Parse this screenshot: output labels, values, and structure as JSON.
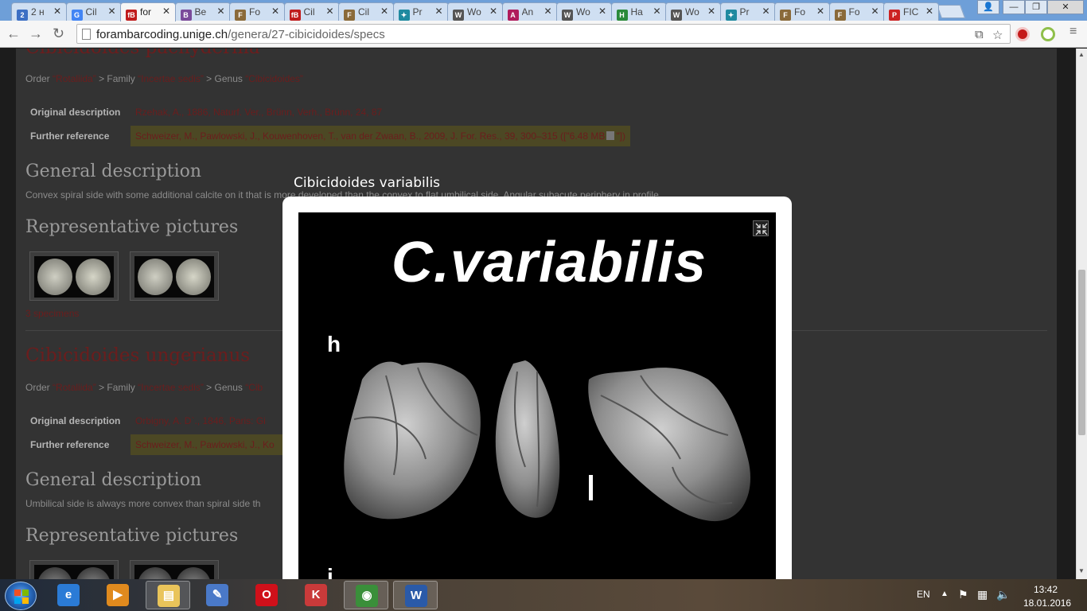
{
  "browser": {
    "tabs": [
      {
        "label": "2 н",
        "color": "#3c6fc4",
        "glyph": "2"
      },
      {
        "label": "Cil",
        "color": "#4285f4",
        "glyph": "G"
      },
      {
        "label": "for",
        "color": "#c01c1c",
        "glyph": "fB",
        "active": true
      },
      {
        "label": "Be",
        "color": "#7a4a9a",
        "glyph": "B"
      },
      {
        "label": "Fo",
        "color": "#8a6a3a",
        "glyph": "F"
      },
      {
        "label": "Cil",
        "color": "#c01c1c",
        "glyph": "fB"
      },
      {
        "label": "Cil",
        "color": "#8a6a3a",
        "glyph": "F"
      },
      {
        "label": "Pr",
        "color": "#1f8aa0",
        "glyph": "✦"
      },
      {
        "label": "Wo",
        "color": "#555555",
        "glyph": "W"
      },
      {
        "label": "An",
        "color": "#b01c5c",
        "glyph": "A"
      },
      {
        "label": "Wo",
        "color": "#555555",
        "glyph": "W"
      },
      {
        "label": "Ha",
        "color": "#2a8a3a",
        "glyph": "H"
      },
      {
        "label": "Wo",
        "color": "#555555",
        "glyph": "W"
      },
      {
        "label": "Pr",
        "color": "#1f8aa0",
        "glyph": "✦"
      },
      {
        "label": "Fo",
        "color": "#8a6a3a",
        "glyph": "F"
      },
      {
        "label": "Fo",
        "color": "#8a6a3a",
        "glyph": "F"
      },
      {
        "label": "FIC",
        "color": "#cc2222",
        "glyph": "P"
      }
    ],
    "url_host": "forambarcoding.unige.ch",
    "url_path": "/genera/27-cibicidoides/specs"
  },
  "page": {
    "species1": {
      "title": "Cibicidoides pachyderma",
      "crumb_order_label": "Order",
      "crumb_order": "“Rotaliida”",
      "crumb_family_label": "Family",
      "crumb_family": "“Incertae sedis”",
      "crumb_genus_label": "Genus",
      "crumb_genus": "“Cibicidoides”",
      "crumb_sep": ">",
      "orig_label": "Original description",
      "orig_value": "Rzehak, A., 1886, Naturf. Ver., Brünn, Verh., Brünn, 24, 87",
      "further_label": "Further reference",
      "further_value": "Schweizer, M., Pawlowski, J., Kouwenhoven, T., van der Zwaan, B., 2009, J. For. Res., 39, 300–315 ([\"6.48 MB",
      "further_suffix": "\"])",
      "general_heading": "General description",
      "general_text": "Convex spiral side with some additional calcite on it that is more developed than the convex to flat umbilical side. Angular subacute periphery in profile.",
      "pictures_heading": "Representative pictures",
      "specimens": "3 specimens"
    },
    "species2": {
      "title": "Cibicidoides ungerianus",
      "crumb_order_label": "Order",
      "crumb_order": "“Rotaliida”",
      "crumb_family_label": "Family",
      "crumb_family": "“Incertae sedis”",
      "crumb_genus_label": "Genus",
      "crumb_genus": "“Cib",
      "crumb_sep": ">",
      "orig_label": "Original description",
      "orig_value": "Orbigny, A. D`., 1846, Paris: Gi",
      "further_label": "Further reference",
      "further_value": "Schweizer, M., Pawlowski, J., Ko",
      "general_heading": "General description",
      "general_text": "Umbilical side is always more convex than spiral side th",
      "pictures_heading": "Representative pictures"
    }
  },
  "lightbox": {
    "caption": "Cibicidoides variabilis",
    "image_heading": "C.variabilis",
    "letter_h": "h",
    "letter_i": "i",
    "fullscreen_icon": "collapse-arrows-icon"
  },
  "taskbar": {
    "language": "EN",
    "time": "13:42",
    "date": "18.01.2016",
    "apps": [
      {
        "name": "ie",
        "color": "#2b7bd6",
        "glyph": "e"
      },
      {
        "name": "media-player",
        "color": "#e08a1e",
        "glyph": "▶"
      },
      {
        "name": "explorer",
        "color": "#e9c45a",
        "glyph": "▤",
        "open": true
      },
      {
        "name": "tool",
        "color": "#4a79c8",
        "glyph": "✎"
      },
      {
        "name": "opera",
        "color": "#d0101a",
        "glyph": "O"
      },
      {
        "name": "app-red",
        "color": "#c93a3a",
        "glyph": "K"
      },
      {
        "name": "chrome",
        "color": "#3a8f3a",
        "glyph": "◉",
        "open": true
      },
      {
        "name": "word",
        "color": "#2a5aa8",
        "glyph": "W",
        "open": true
      }
    ]
  }
}
